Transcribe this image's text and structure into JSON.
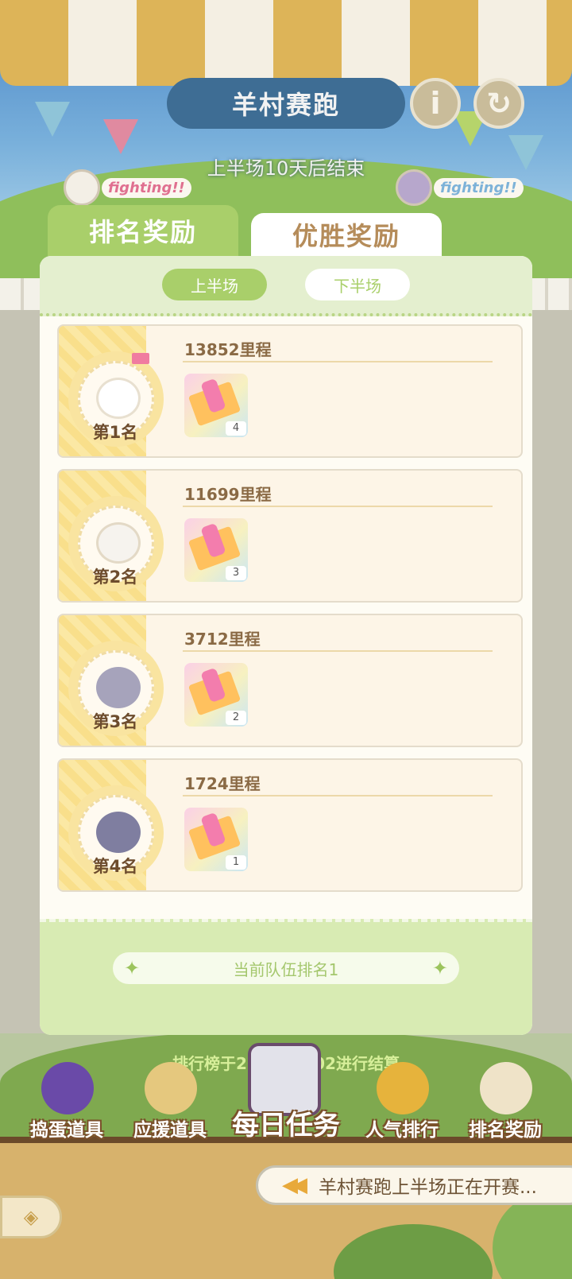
{
  "header": {
    "title": "羊村赛跑",
    "info_icon": "info-icon",
    "refresh_icon": "refresh-icon",
    "countdown": "上半场10天后结束",
    "fighting_left": "fighting!!",
    "fighting_right": "fighting!!"
  },
  "tabs": [
    {
      "label": "排名奖励",
      "active": true
    },
    {
      "label": "优胜奖励",
      "active": false
    }
  ],
  "segments": [
    {
      "label": "上半场",
      "active": true
    },
    {
      "label": "下半场",
      "active": false
    }
  ],
  "rankings": [
    {
      "rank_label": "第1名",
      "miles": "13852里程",
      "reward_qty": "4",
      "avatar": "white-sheep-avatar"
    },
    {
      "rank_label": "第2名",
      "miles": "11699里程",
      "reward_qty": "3",
      "avatar": "elder-sheep-avatar"
    },
    {
      "rank_label": "第3名",
      "miles": "3712里程",
      "reward_qty": "2",
      "avatar": "grey-wolf-cub-avatar"
    },
    {
      "rank_label": "第4名",
      "miles": "1724里程",
      "reward_qty": "1",
      "avatar": "grey-wolf-avatar"
    }
  ],
  "footer": {
    "team_rank": "当前队伍排名1",
    "settlement": "排行榜于2024/03/02进行结算"
  },
  "bottom_nav": {
    "prank_items": "捣蛋道具",
    "support_items": "应援道具",
    "daily_tasks": "每日任务",
    "popularity": "人气排行",
    "rank_rewards": "排名奖励"
  },
  "ticker": {
    "icon": "rewind-icon",
    "text": "羊村赛跑上半场正在开赛..."
  },
  "back_icon": "diamond-arrow-icon",
  "colors": {
    "accent_green": "#a9cf6a",
    "title_blue": "#3e6d94",
    "card_bg": "#fdf5e7",
    "brown_text": "#8a6a45"
  }
}
